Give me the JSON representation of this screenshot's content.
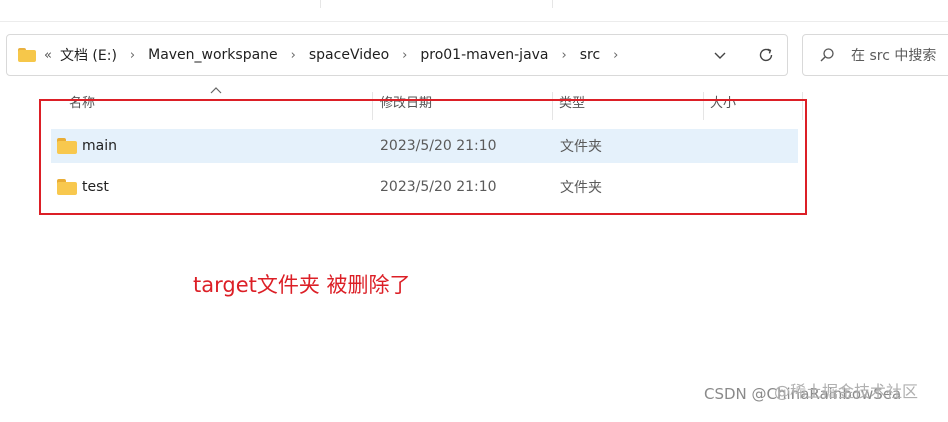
{
  "address_bar": {
    "overflow_label": "«",
    "breadcrumbs": [
      "文档 (E:)",
      "Maven_workspane",
      "spaceVideo",
      "pro01-maven-java",
      "src"
    ],
    "separator": "›"
  },
  "search": {
    "placeholder": "在 src 中搜索"
  },
  "columns": {
    "name": "名称",
    "modified": "修改日期",
    "type": "类型",
    "size": "大小"
  },
  "rows": [
    {
      "name": "main",
      "modified": "2023/5/20 21:10",
      "type": "文件夹",
      "selected": true
    },
    {
      "name": "test",
      "modified": "2023/5/20 21:10",
      "type": "文件夹",
      "selected": false
    }
  ],
  "annotation": {
    "text": "target文件夹 被删除了",
    "color": "#dc1f26"
  },
  "watermark": {
    "line1": "CSDN @ChinaRainbowSea",
    "line2": "@稀土掘金技术社区"
  },
  "colors": {
    "selection": "#e5f1fb",
    "folder": "#f8c84e",
    "annotation_red": "#dc1f26"
  },
  "icons": [
    "folder-icon",
    "chevron-right-icon",
    "chevron-down-icon",
    "refresh-icon",
    "search-icon",
    "sort-up-icon"
  ]
}
